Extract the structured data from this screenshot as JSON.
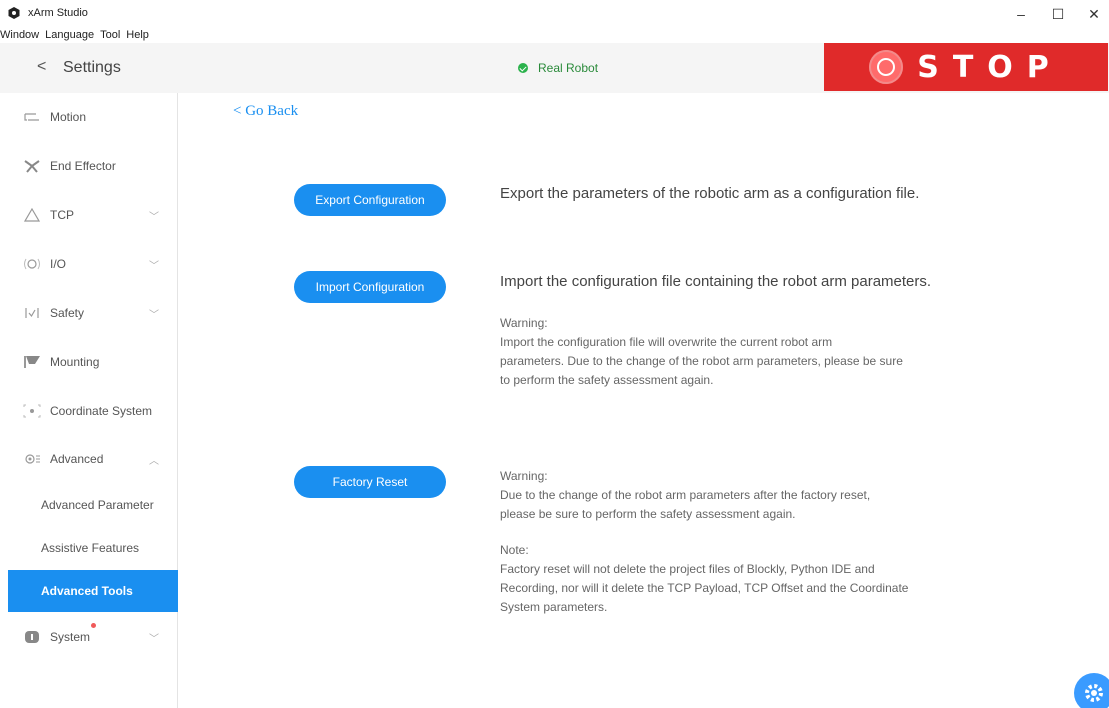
{
  "window": {
    "title": "xArm Studio",
    "minimize": "–",
    "maximize": "☐",
    "close": "✕"
  },
  "menu": [
    "Window",
    "Language",
    "Tool",
    "Help"
  ],
  "header": {
    "back_chevron": "<",
    "title": "Settings",
    "status": "Real Robot",
    "status_color": "#2bb24c",
    "stop_label": "STOP",
    "stop_color": "#e02a2a"
  },
  "sidebar": {
    "items": [
      {
        "label": "Motion",
        "icon": "motion-icon",
        "chevron": ""
      },
      {
        "label": "End Effector",
        "icon": "end-effector-icon",
        "chevron": ""
      },
      {
        "label": "TCP",
        "icon": "tcp-icon",
        "chevron": "﹀"
      },
      {
        "label": "I/O",
        "icon": "io-icon",
        "chevron": "﹀"
      },
      {
        "label": "Safety",
        "icon": "safety-icon",
        "chevron": "﹀"
      },
      {
        "label": "Mounting",
        "icon": "mounting-icon",
        "chevron": ""
      },
      {
        "label": "Coordinate System",
        "icon": "coordinate-system-icon",
        "chevron": ""
      },
      {
        "label": "Advanced",
        "icon": "advanced-icon",
        "chevron": "︿"
      }
    ],
    "sub_items": [
      {
        "label": "Advanced Parameter"
      },
      {
        "label": "Assistive Features"
      },
      {
        "label": "Advanced Tools",
        "active": true
      }
    ],
    "system": {
      "label": "System",
      "icon": "system-icon",
      "chevron": "﹀"
    },
    "accent_color": "#1a8ff0"
  },
  "main": {
    "go_back": "< Go Back",
    "export": {
      "button": "Export Configuration",
      "description": "Export the parameters of the robotic arm as a configuration file."
    },
    "import": {
      "button": "Import Configuration",
      "description": "Import the configuration file containing the robot arm parameters.",
      "warning_title": "Warning:",
      "warning_lines": [
        "Import the configuration file will overwrite the current robot arm",
        "parameters. Due to the change of the robot arm parameters, please be sure",
        "to perform the safety assessment again."
      ]
    },
    "factory_reset": {
      "button": "Factory Reset",
      "warning_title": "Warning:",
      "warning_lines": [
        "Due to the change of the robot arm parameters after the factory reset,",
        "please be sure to perform the safety assessment again."
      ],
      "note_title": "Note:",
      "note_lines": [
        "Factory reset will not delete the project files of Blockly, Python IDE and",
        "Recording, nor will it delete the TCP Payload, TCP Offset and the Coordinate",
        "System parameters."
      ]
    }
  }
}
